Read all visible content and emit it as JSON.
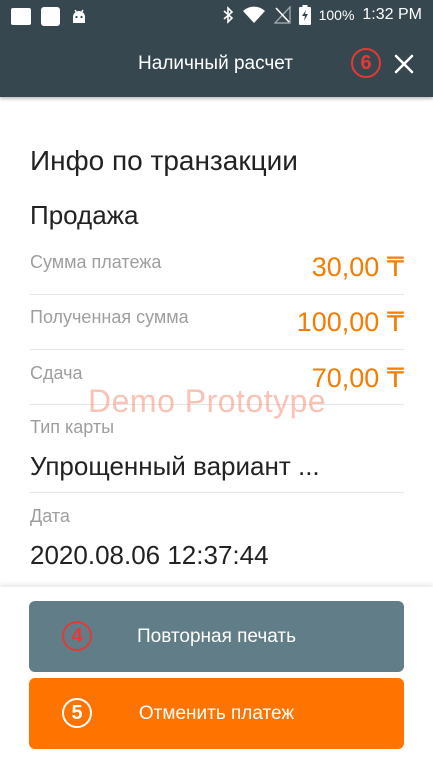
{
  "statusbar": {
    "battery": "100%",
    "time": "1:32 PM",
    "icons": [
      "message-icon",
      "image-icon",
      "android-icon",
      "bluetooth-icon",
      "wifi-icon",
      "no-signal-icon",
      "battery-charging-icon"
    ]
  },
  "appbar": {
    "title": "Наличный расчет",
    "marker": "6",
    "close_icon": "close-icon"
  },
  "content": {
    "heading": "Инфо по  транзакции",
    "subheading": "Продажа",
    "rows": [
      {
        "label": "Сумма платежа",
        "value": "30,00 ₸"
      },
      {
        "label": "Полученная сумма",
        "value": "100,00 ₸"
      },
      {
        "label": "Сдача",
        "value": "70,00 ₸"
      }
    ],
    "watermark": "Demo Prototype",
    "card_type": {
      "label": "Тип карты",
      "value": "Упрощенный вариант ..."
    },
    "date": {
      "label": "Дата",
      "value": "2020.08.06 12:37:44"
    }
  },
  "footer": {
    "reprint": {
      "label": "Повторная печать",
      "marker": "4"
    },
    "cancel": {
      "label": "Отменить платеж",
      "marker": "5"
    }
  },
  "colors": {
    "header": "#37474f",
    "accent": "#ff7400",
    "amount": "#f57c00",
    "reprint_button": "#607d88",
    "marker": "#e53935"
  }
}
